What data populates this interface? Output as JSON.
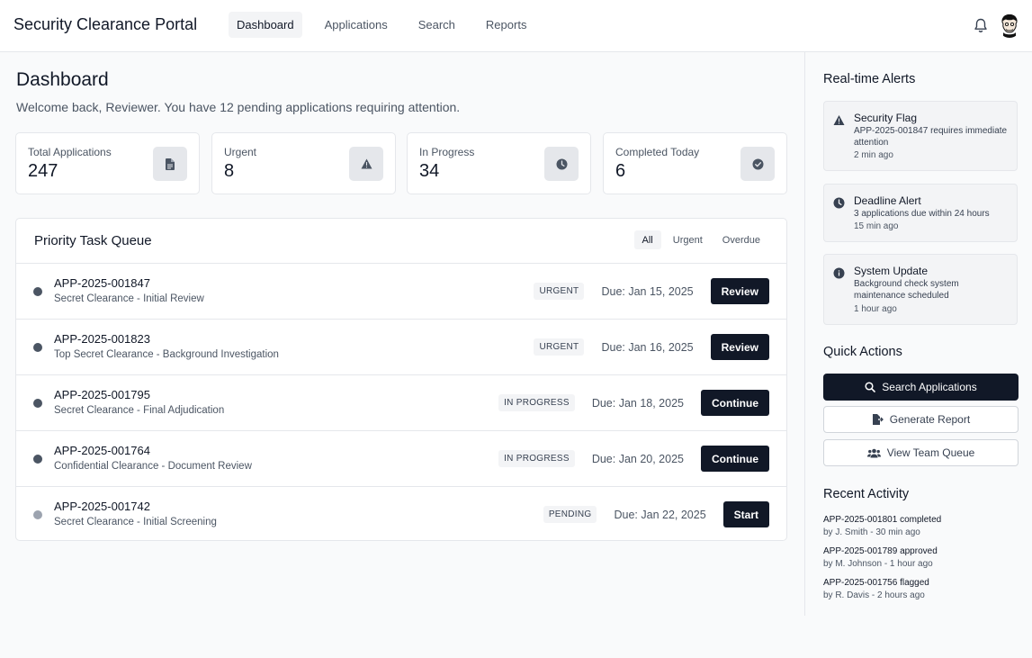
{
  "app": {
    "title": "Security Clearance Portal"
  },
  "nav": [
    {
      "label": "Dashboard",
      "active": true
    },
    {
      "label": "Applications",
      "active": false
    },
    {
      "label": "Search",
      "active": false
    },
    {
      "label": "Reports",
      "active": false
    }
  ],
  "header": {
    "icons": [
      "bell-icon",
      "user-avatar"
    ]
  },
  "page": {
    "title": "Dashboard",
    "welcome": "Welcome back, Reviewer. You have 12 pending applications requiring attention."
  },
  "stats": [
    {
      "label": "Total Applications",
      "value": "247",
      "icon": "file-icon"
    },
    {
      "label": "Urgent",
      "value": "8",
      "icon": "warning-icon"
    },
    {
      "label": "In Progress",
      "value": "34",
      "icon": "clock-icon"
    },
    {
      "label": "Completed Today",
      "value": "6",
      "icon": "check-circle-icon"
    }
  ],
  "queue": {
    "title": "Priority Task Queue",
    "filters": [
      "All",
      "Urgent",
      "Overdue"
    ],
    "active_filter": "All",
    "items": [
      {
        "id": "APP-2025-001847",
        "desc": "Secret Clearance - Initial Review",
        "status": "URGENT",
        "due": "Due: Jan 15, 2025",
        "action": "Review"
      },
      {
        "id": "APP-2025-001823",
        "desc": "Top Secret Clearance - Background Investigation",
        "status": "URGENT",
        "due": "Due: Jan 16, 2025",
        "action": "Review"
      },
      {
        "id": "APP-2025-001795",
        "desc": "Secret Clearance - Final Adjudication",
        "status": "IN PROGRESS",
        "due": "Due: Jan 18, 2025",
        "action": "Continue"
      },
      {
        "id": "APP-2025-001764",
        "desc": "Confidential Clearance - Document Review",
        "status": "IN PROGRESS",
        "due": "Due: Jan 20, 2025",
        "action": "Continue"
      },
      {
        "id": "APP-2025-001742",
        "desc": "Secret Clearance - Initial Screening",
        "status": "PENDING",
        "due": "Due: Jan 22, 2025",
        "action": "Start"
      }
    ]
  },
  "alerts": {
    "title": "Real-time Alerts",
    "items": [
      {
        "title": "Security Flag",
        "text": "APP-2025-001847 requires immediate attention",
        "time": "2 min ago",
        "icon": "warning-icon"
      },
      {
        "title": "Deadline Alert",
        "text": "3 applications due within 24 hours",
        "time": "15 min ago",
        "icon": "clock-icon"
      },
      {
        "title": "System Update",
        "text": "Background check system maintenance scheduled",
        "time": "1 hour ago",
        "icon": "info-icon"
      }
    ]
  },
  "quick_actions": {
    "title": "Quick Actions",
    "items": [
      {
        "label": "Search Applications",
        "icon": "search-icon"
      },
      {
        "label": "Generate Report",
        "icon": "file-export-icon"
      },
      {
        "label": "View Team Queue",
        "icon": "users-icon"
      }
    ]
  },
  "recent_activity": {
    "title": "Recent Activity",
    "items": [
      {
        "title": "APP-2025-001801 completed",
        "sub": "by J. Smith - 30 min ago"
      },
      {
        "title": "APP-2025-001789 approved",
        "sub": "by M. Johnson - 1 hour ago"
      },
      {
        "title": "APP-2025-001756 flagged",
        "sub": "by R. Davis - 2 hours ago"
      }
    ]
  },
  "colors": {
    "primary": "#111827",
    "muted_text": "#4b5563",
    "border": "#e5e7eb",
    "surface": "#f3f4f6",
    "background": "#f9fafb"
  }
}
